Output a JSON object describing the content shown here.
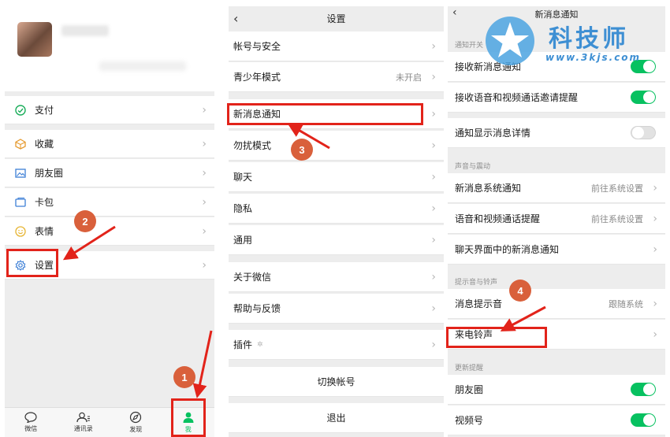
{
  "panel1": {
    "menu": [
      {
        "label": "支付",
        "icon": "payment-icon"
      },
      {
        "label": "收藏",
        "icon": "favorites-icon"
      },
      {
        "label": "朋友圈",
        "icon": "moments-icon"
      },
      {
        "label": "卡包",
        "icon": "card-wallet-icon"
      },
      {
        "label": "表情",
        "icon": "stickers-icon"
      },
      {
        "label": "设置",
        "icon": "gear-icon"
      }
    ],
    "tabs": [
      {
        "label": "微信",
        "icon": "chat-icon"
      },
      {
        "label": "通讯录",
        "icon": "contacts-icon"
      },
      {
        "label": "发现",
        "icon": "discover-icon"
      },
      {
        "label": "我",
        "icon": "me-icon"
      }
    ]
  },
  "panel2": {
    "title": "设置",
    "items": [
      {
        "label": "帐号与安全",
        "value": ""
      },
      {
        "label": "青少年模式",
        "value": "未开启"
      },
      {
        "label": "新消息通知",
        "value": ""
      },
      {
        "label": "勿扰模式",
        "value": ""
      },
      {
        "label": "聊天",
        "value": ""
      },
      {
        "label": "隐私",
        "value": ""
      },
      {
        "label": "通用",
        "value": ""
      },
      {
        "label": "关于微信",
        "value": ""
      },
      {
        "label": "帮助与反馈",
        "value": ""
      },
      {
        "label": "插件",
        "value": ""
      }
    ],
    "switch_account": "切换帐号",
    "logout": "退出"
  },
  "panel3": {
    "title": "新消息通知",
    "sections": {
      "notify_switch": "通知开关",
      "sound_vibration": "声音与震动",
      "tone_ringtone": "提示音与铃声",
      "updates": "更新提醒"
    },
    "rows": {
      "receive_new": "接收新消息通知",
      "receive_call": "接收语音和视频通话邀请提醒",
      "show_detail": "通知显示消息详情",
      "sys_notify": "新消息系统通知",
      "sys_notify_value": "前往系统设置",
      "call_alert": "语音和视频通话提醒",
      "call_alert_value": "前往系统设置",
      "in_chat": "聊天界面中的新消息通知",
      "msg_tone": "消息提示音",
      "msg_tone_value": "跟随系统",
      "ringtone": "来电铃声",
      "moments": "朋友圈",
      "channels": "视频号"
    },
    "toggles": {
      "receive_new": true,
      "receive_call": true,
      "show_detail": false,
      "moments": true,
      "channels": true
    }
  },
  "steps": [
    "1",
    "2",
    "3",
    "4"
  ],
  "watermark": {
    "name": "科技师",
    "url": "www.3kjs.com"
  },
  "colors": {
    "accent_green": "#07c160",
    "annotation_red": "#e2231a",
    "badge": "#d9603b"
  }
}
